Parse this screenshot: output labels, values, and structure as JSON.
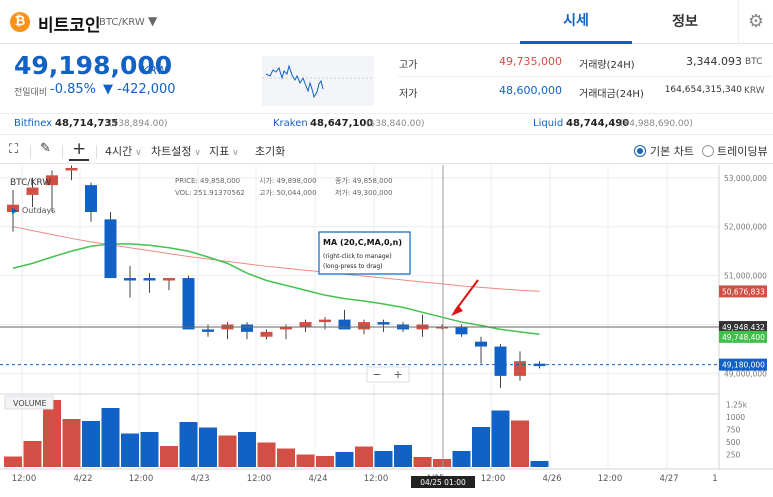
{
  "header": {
    "coin_logo": "₿",
    "coin_name": "비트코인",
    "coin_pair": "BTC/KRW",
    "dropdown_icon": "caret-down-icon",
    "tabs": [
      {
        "label": "시세",
        "active": true
      },
      {
        "label": "정보",
        "active": false
      }
    ],
    "settings_icon": "gear-icon"
  },
  "price_panel": {
    "current_price": "49,198,000",
    "unit": "KRW",
    "change_label": "전일대비",
    "change_pct": "-0.85%",
    "change_abs": "▼ -422,000",
    "high_label": "고가",
    "high_value": "49,735,000",
    "low_label": "저가",
    "low_value": "48,600,000",
    "volume_label": "거래량(24H)",
    "volume_value": "3,344.093",
    "volume_unit": "BTC",
    "amount_label": "거래대금(24H)",
    "amount_value": "164,654,315,340",
    "amount_unit": "KRW",
    "colors": {
      "up": "#d24f45",
      "down": "#1261c4"
    }
  },
  "exchanges": [
    {
      "name": "Bitfinex",
      "price": "48,714,735",
      "usd": "($38,894.00)"
    },
    {
      "name": "Kraken",
      "price": "48,647,100",
      "usd": "($38,840.00)"
    },
    {
      "name": "Liquid",
      "price": "48,744,490",
      "usd": "(¥4,988,690.00)"
    }
  ],
  "toolbar": {
    "fullscreen_icon": "fullscreen-icon",
    "pencil_icon": "pencil-icon",
    "crosshair_icon": "crosshair-icon",
    "interval": "4시간",
    "chart_settings": "차트설정",
    "indicators": "지표",
    "reset": "초기화",
    "basic_chart": "기본 차트",
    "trading_view": "트레이딩뷰"
  },
  "chart_data": {
    "type": "candlestick",
    "symbol": "BTC/KRW",
    "outdays_label": "Outdays",
    "ohlc_header": {
      "price_label": "PRICE:",
      "price": "49,858,000",
      "open_label": "시가:",
      "open": "49,898,000",
      "close_label": "종가:",
      "close": "49,858,000",
      "vol_label": "VOL:",
      "vol": "251.91370562",
      "high_label": "고가:",
      "high": "50,044,000",
      "low_label": "저가:",
      "low": "49,300,000"
    },
    "ma_label": {
      "title": "MA (20,C,MA,0,n)",
      "line1": "(right-click to manage)",
      "line2": "(long-press to drag)"
    },
    "volume_label": "VOLUME",
    "y_range": [
      48600000,
      53200000
    ],
    "y_ticks": [
      53000000,
      52000000,
      51000000,
      50000000,
      49000000
    ],
    "y_tick_labels": [
      "53,000,000",
      "52,000,000",
      "51,000,000",
      "50,000,000",
      "49,000,000"
    ],
    "price_tags": [
      {
        "label": "50,676,833",
        "value": 50676833,
        "color": "#d24f45"
      },
      {
        "label": "49,948,432",
        "value": 49948432,
        "color": "#333333"
      },
      {
        "label": "49,748,400",
        "value": 49748400,
        "color": "#3ec04a"
      },
      {
        "label": "49,180,000",
        "value": 49180000,
        "color": "#1261c4"
      }
    ],
    "vol_range": [
      0,
      1400
    ],
    "vol_ticks": [
      1250,
      1000,
      750,
      500,
      250
    ],
    "vol_tick_labels": [
      "1.25k",
      "1000",
      "750",
      "500",
      "250"
    ],
    "x_labels": [
      "12:00",
      "4/22",
      "12:00",
      "4/23",
      "12:00",
      "4/24",
      "12:00",
      "4/25",
      "12:00",
      "4/26",
      "12:00",
      "4/27",
      "1"
    ],
    "cursor_time": "04/25 01:00",
    "zoom_out": "−",
    "zoom_in": "+",
    "candles": [
      {
        "o": 52300000,
        "h": 52750000,
        "l": 51900000,
        "c": 52450000,
        "v": 210
      },
      {
        "o": 52650000,
        "h": 53000000,
        "l": 52400000,
        "c": 52800000,
        "v": 520
      },
      {
        "o": 52850000,
        "h": 53150000,
        "l": 52300000,
        "c": 53050000,
        "v": 1340
      },
      {
        "o": 53150000,
        "h": 53250000,
        "l": 52950000,
        "c": 53200000,
        "v": 960
      },
      {
        "o": 52850000,
        "h": 52900000,
        "l": 52100000,
        "c": 52300000,
        "v": 920
      },
      {
        "o": 52150000,
        "h": 52300000,
        "l": 51000000,
        "c": 50950000,
        "v": 1180
      },
      {
        "o": 50950000,
        "h": 51200000,
        "l": 50550000,
        "c": 50900000,
        "v": 670
      },
      {
        "o": 50950000,
        "h": 51050000,
        "l": 50650000,
        "c": 50900000,
        "v": 700
      },
      {
        "o": 50900000,
        "h": 50950000,
        "l": 50700000,
        "c": 50950000,
        "v": 420
      },
      {
        "o": 50950000,
        "h": 51000000,
        "l": 49900000,
        "c": 49900000,
        "v": 900
      },
      {
        "o": 49900000,
        "h": 50000000,
        "l": 49750000,
        "c": 49850000,
        "v": 790
      },
      {
        "o": 49900000,
        "h": 50050000,
        "l": 49700000,
        "c": 50000000,
        "v": 630
      },
      {
        "o": 50000000,
        "h": 50050000,
        "l": 49700000,
        "c": 49850000,
        "v": 700
      },
      {
        "o": 49750000,
        "h": 49900000,
        "l": 49700000,
        "c": 49850000,
        "v": 490
      },
      {
        "o": 49900000,
        "h": 50000000,
        "l": 49700000,
        "c": 49950000,
        "v": 370
      },
      {
        "o": 49950000,
        "h": 50100000,
        "l": 49850000,
        "c": 50050000,
        "v": 250
      },
      {
        "o": 50050000,
        "h": 50150000,
        "l": 49900000,
        "c": 50100000,
        "v": 220
      },
      {
        "o": 50100000,
        "h": 50300000,
        "l": 49900000,
        "c": 49900000,
        "v": 300
      },
      {
        "o": 49900000,
        "h": 50100000,
        "l": 49800000,
        "c": 50050000,
        "v": 410
      },
      {
        "o": 50050000,
        "h": 50100000,
        "l": 49850000,
        "c": 50000000,
        "v": 320
      },
      {
        "o": 50000000,
        "h": 50050000,
        "l": 49850000,
        "c": 49900000,
        "v": 440
      },
      {
        "o": 49900000,
        "h": 50200000,
        "l": 49750000,
        "c": 50000000,
        "v": 200
      },
      {
        "o": 49950000,
        "h": 50000000,
        "l": 49900000,
        "c": 49950000,
        "v": 160
      },
      {
        "o": 49950000,
        "h": 50000000,
        "l": 49750000,
        "c": 49800000,
        "v": 320
      },
      {
        "o": 49650000,
        "h": 49750000,
        "l": 49200000,
        "c": 49550000,
        "v": 800
      },
      {
        "o": 49550000,
        "h": 49600000,
        "l": 48700000,
        "c": 48950000,
        "v": 1130
      },
      {
        "o": 48950000,
        "h": 49450000,
        "l": 48850000,
        "c": 49250000,
        "v": 930
      },
      {
        "o": 49200000,
        "h": 49250000,
        "l": 49100000,
        "c": 49150000,
        "v": 120
      }
    ],
    "ma_series": {
      "name": "MA 20",
      "color": "#44c24f",
      "values": [
        51150000,
        51250000,
        51380000,
        51500000,
        51600000,
        51650000,
        51650000,
        51620000,
        51570000,
        51500000,
        51380000,
        51250000,
        51050000,
        50900000,
        50800000,
        50700000,
        50600000,
        50530000,
        50480000,
        50420000,
        50350000,
        50250000,
        50150000,
        50050000,
        49980000,
        49900000,
        49850000,
        49800000
      ]
    },
    "long_ma_series": {
      "name": "MA long",
      "color": "#f08a80",
      "values": [
        52000000,
        51920000,
        51840000,
        51760000,
        51690000,
        51630000,
        51570000,
        51510000,
        51450000,
        51390000,
        51340000,
        51290000,
        51240000,
        51190000,
        51150000,
        51110000,
        51070000,
        51030000,
        50990000,
        50950000,
        50910000,
        50870000,
        50830000,
        50790000,
        50760000,
        50730000,
        50700000,
        50680000
      ]
    }
  }
}
